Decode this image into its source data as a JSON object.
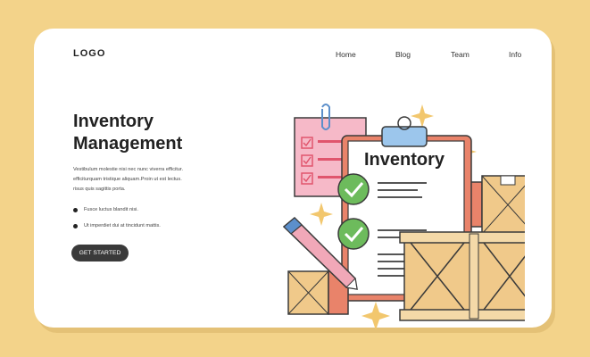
{
  "header": {
    "logo": "LOGO",
    "nav": [
      "Home",
      "Blog",
      "Team",
      "Info"
    ]
  },
  "hero": {
    "title_line1": "Inventory",
    "title_line2": "Management",
    "description": "Vestibulum molestie nisi nec nunc viverra efficitur. efficiturquam tristique aliquam.Proin ut est lectus. risus quis sagittis porta.",
    "bullets": [
      "Fusce luctus blandit nisi.",
      "Ut imperdiet dui at tincidunt mattis."
    ],
    "cta_label": "GET STARTED"
  },
  "illustration": {
    "clipboard_title": "Inventory"
  },
  "colors": {
    "background": "#F3D38A",
    "card": "#FFFFFF",
    "button": "#3A3A3A",
    "check_green": "#6DBB5C",
    "crate": "#F0C98A",
    "pink_note": "#F6B9C8"
  }
}
